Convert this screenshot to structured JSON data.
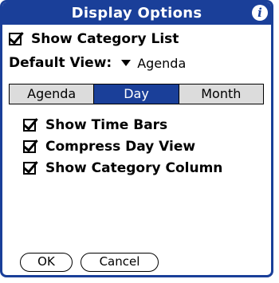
{
  "dialog": {
    "title": "Display Options",
    "info_icon_glyph": "i"
  },
  "show_category_list": {
    "label": "Show Category List",
    "checked": true
  },
  "default_view": {
    "label": "Default View:",
    "value": "Agenda"
  },
  "view_tabs": [
    {
      "label": "Agenda",
      "selected": false
    },
    {
      "label": "Day",
      "selected": true
    },
    {
      "label": "Month",
      "selected": false
    }
  ],
  "day_options": [
    {
      "label": "Show Time Bars",
      "checked": true
    },
    {
      "label": "Compress Day View",
      "checked": true
    },
    {
      "label": "Show Category Column",
      "checked": true
    }
  ],
  "buttons": {
    "ok": "OK",
    "cancel": "Cancel"
  },
  "colors": {
    "accent": "#1a3f99",
    "tab_bg": "#dcdcdc",
    "background": "#ffffff"
  }
}
